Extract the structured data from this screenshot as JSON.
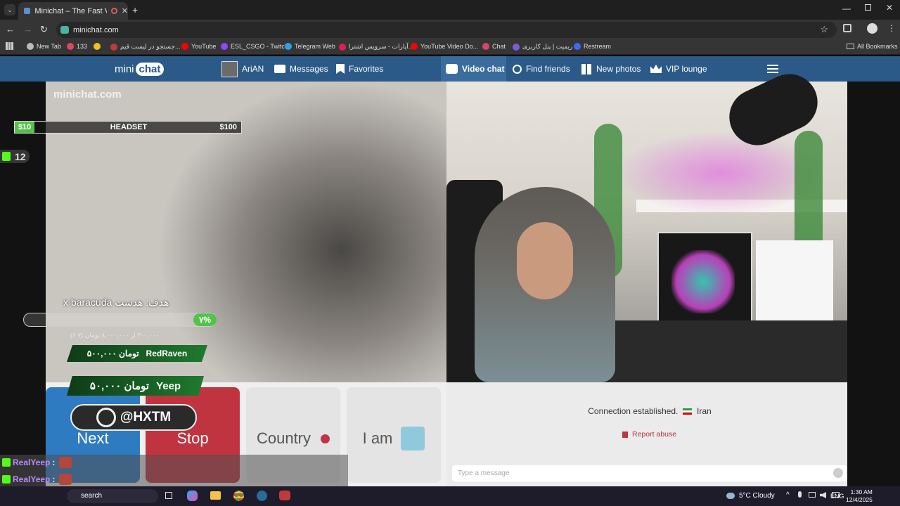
{
  "browser": {
    "tab_title": "Minichat – The Fast Video C",
    "url": "minichat.com",
    "bookmarks": [
      {
        "label": "New Tab",
        "icon": "globe-icon",
        "color": "#bbbbbb"
      },
      {
        "label": "133",
        "icon": "site-icon",
        "color": "#e0455b"
      },
      {
        "label": "",
        "icon": "smiley-icon",
        "color": "#f2c01e"
      },
      {
        "label": "جستجو در لیست قیم...",
        "icon": "site-icon",
        "color": "#c23b3b"
      },
      {
        "label": "YouTube",
        "icon": "youtube-icon",
        "color": "#ff0000"
      },
      {
        "label": "ESL_CSGO - Twitch",
        "icon": "twitch-icon",
        "color": "#9146ff"
      },
      {
        "label": "Telegram Web",
        "icon": "telegram-icon",
        "color": "#2aa3e0"
      },
      {
        "label": "آپارات - سرویس اشترا...",
        "icon": "aparat-icon",
        "color": "#df1e57"
      },
      {
        "label": "YouTube Video Do...",
        "icon": "youtube-icon",
        "color": "#ff0000"
      },
      {
        "label": "Chat",
        "icon": "chat-icon",
        "color": "#d9456a"
      },
      {
        "label": "ریمیت | پنل کاربری",
        "icon": "site-icon",
        "color": "#7c5cd6"
      },
      {
        "label": "Restream",
        "icon": "restream-icon",
        "color": "#3d6bf0"
      }
    ],
    "all_bookmarks": "All Bookmarks"
  },
  "nav": {
    "logo_mini": "mini",
    "logo_chat": "chat",
    "user": "AriAN",
    "messages": "Messages",
    "favorites": "Favorites",
    "video_chat": "Video chat",
    "find_friends": "Find friends",
    "new_photos": "New photos",
    "vip_lounge": "VIP lounge"
  },
  "video": {
    "watermark": "minichat.com",
    "connection": "Connection established.",
    "country": "Iran",
    "report": "Report abuse"
  },
  "buttons": {
    "next": "Next",
    "stop": "Stop",
    "country": "Country",
    "iam": "I am"
  },
  "chat": {
    "placeholder": "Type a message"
  },
  "overlay": {
    "goal_min": "$10",
    "goal_name": "HEADSET",
    "goal_max": "$100",
    "kick_count": "12",
    "goal_title": "هدف: هدست x baracuda",
    "goal_percent": "٧%",
    "goal_amount": "۳۰۰,۰۰۰ از ۸,۰۰۰,۰۰۰ تومان (۶.۷)",
    "donations": [
      {
        "name": "RedRaven",
        "amount": "۵۰۰,۰۰۰ تومان"
      },
      {
        "name": "Yeep",
        "amount": "۵۰,۰۰۰ تومان"
      }
    ],
    "handle": "@HXTM",
    "chat_user": "RealYeep",
    "chat_rows": 3
  },
  "taskbar": {
    "search": "search",
    "weather": "5°C  Cloudy",
    "lang": "ENG",
    "time": "1:30 AM",
    "date": "12/4/2025"
  }
}
